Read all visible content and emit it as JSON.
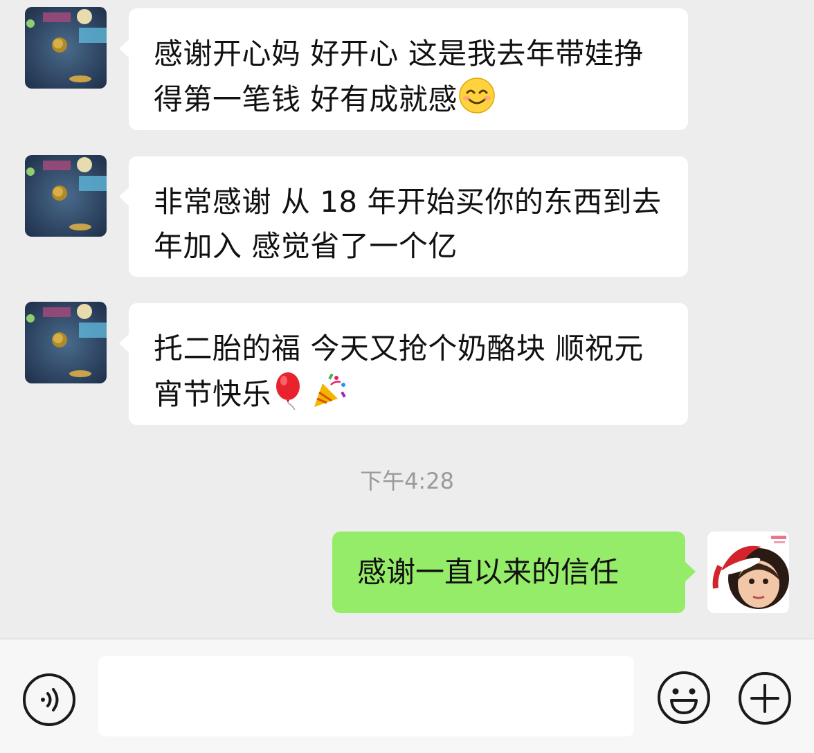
{
  "messages": [
    {
      "sender": "other",
      "text_main": "感谢开心妈 好开心 这是我去年带娃挣得第一笔钱 好有成就感",
      "emoji": "smiling-face-icon"
    },
    {
      "sender": "other",
      "text_main": "非常感谢 从 18 年开始买你的东西到去年加入 感觉省了一个亿"
    },
    {
      "sender": "other",
      "text_main": "托二胎的福 今天又抢个奶酪块 顺祝元宵节快乐",
      "emoji": [
        "balloon-icon",
        "party-popper-icon"
      ]
    }
  ],
  "timestamp": "下午4:28",
  "my_message": "感谢一直以来的信任",
  "input": {
    "value": "",
    "placeholder": ""
  },
  "icons": {
    "voice": "voice-icon",
    "emoji": "emoji-icon",
    "plus": "plus-icon"
  },
  "colors": {
    "background": "#ededed",
    "bubble_other": "#ffffff",
    "bubble_self": "#95ec69",
    "timestamp": "#9a9a9a",
    "input_bar": "#f7f7f7"
  }
}
